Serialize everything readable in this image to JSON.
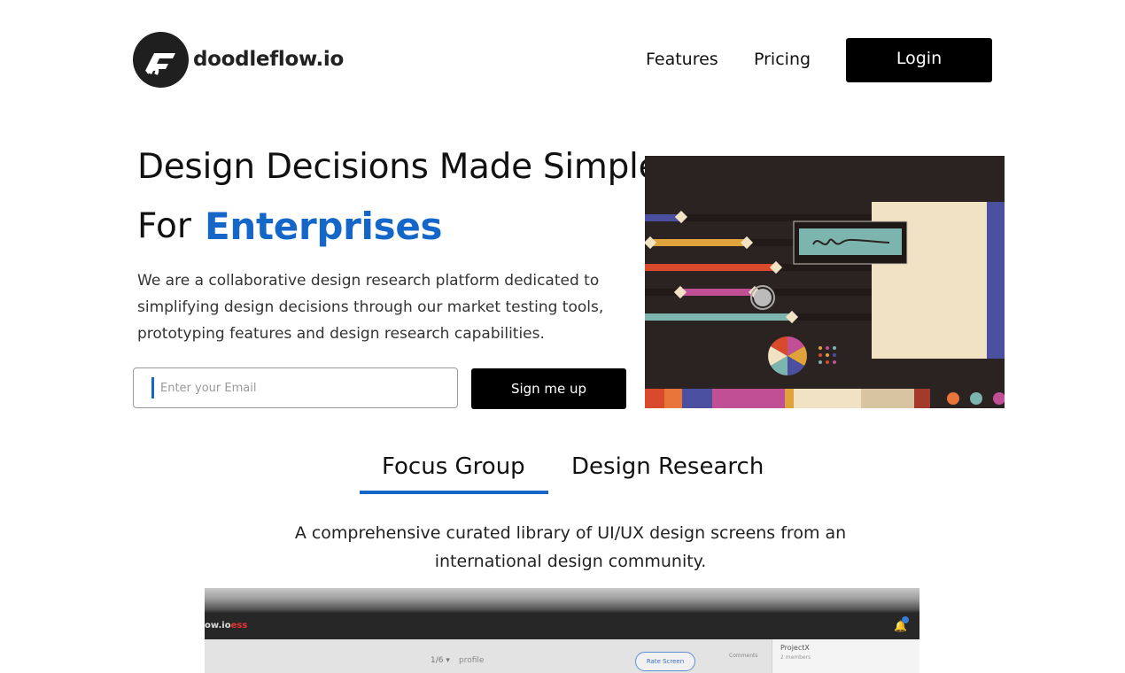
{
  "brand": {
    "name": "doodleflow.io",
    "logo_icon": "doodleflow-logo-icon"
  },
  "nav": {
    "features": "Features",
    "pricing": "Pricing",
    "login": "Login"
  },
  "hero": {
    "title": "Design Decisions Made Simple",
    "for_label": "For",
    "accent": "Enterprises",
    "description": "We are a collaborative design research platform dedicated to simplifying design decisions through our market testing tools, prototyping features and design research capabilities.",
    "email_placeholder": "Enter your Email",
    "signup_label": "Sign me up",
    "illustration_icon": "design-research-illustration"
  },
  "tabs": {
    "items": [
      {
        "label": "Focus Group",
        "active": true
      },
      {
        "label": "Design Research",
        "active": false
      }
    ],
    "description": "A comprehensive curated library of UI/UX design screens from an international design community."
  },
  "preview": {
    "brand": "ow.io",
    "brand_tag": "ess",
    "counter": "1/6 ▾",
    "profile": "profile",
    "rate_button": "Rate Screen",
    "comments": "Comments",
    "project": "ProjectX",
    "members": "2 members",
    "notification_icon": "bell-icon"
  },
  "colors": {
    "accent": "#1467c8",
    "button": "#000000",
    "illustration_bg": "#2b2322"
  }
}
